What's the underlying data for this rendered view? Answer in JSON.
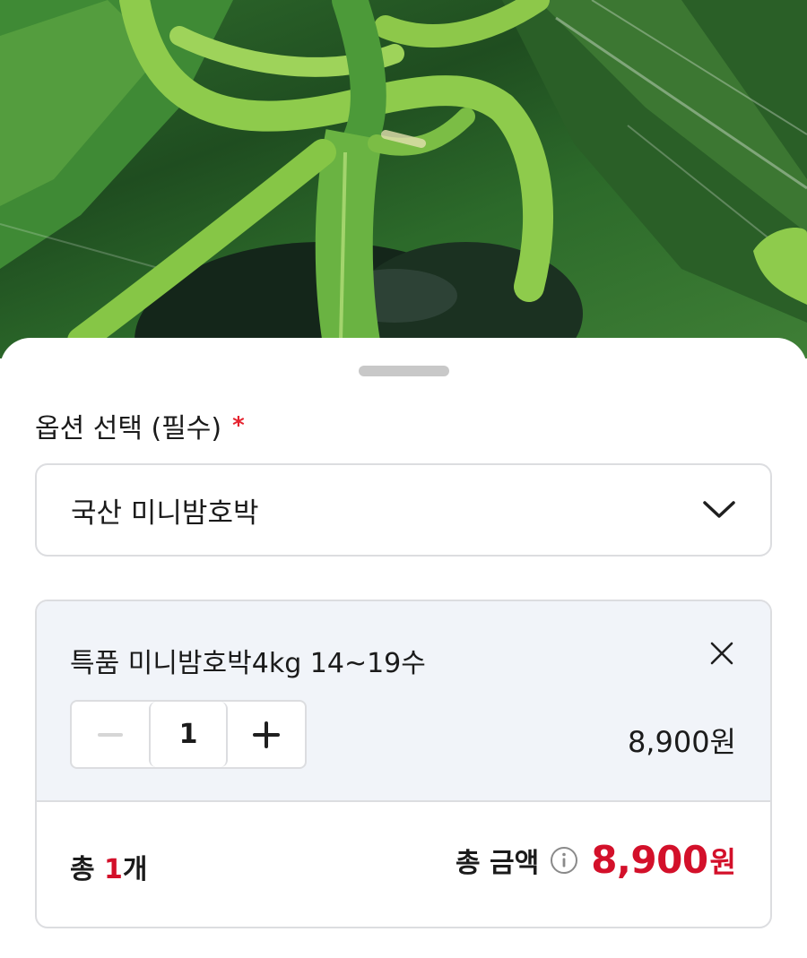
{
  "option_section": {
    "title": "옵션 선택 (필수)",
    "required_mark": "*",
    "selected_value": "국산 미니밤호박"
  },
  "selected_option": {
    "name": "특품 미니밤호박4kg 14~19수",
    "quantity": "1",
    "price": "8,900원"
  },
  "summary": {
    "count_prefix": "총 ",
    "count_value": "1",
    "count_suffix": "개",
    "total_label": "총 금액",
    "total_amount": "8,900",
    "total_unit": "원"
  },
  "icons": {
    "dropdown": "chevron-down-icon",
    "remove": "close-icon",
    "decrease": "minus-icon",
    "increase": "plus-icon",
    "info": "info-icon"
  },
  "colors": {
    "accent": "#d3102a",
    "required": "#e5232f",
    "card_background": "#f1f4f9",
    "border": "#dcdde0"
  }
}
